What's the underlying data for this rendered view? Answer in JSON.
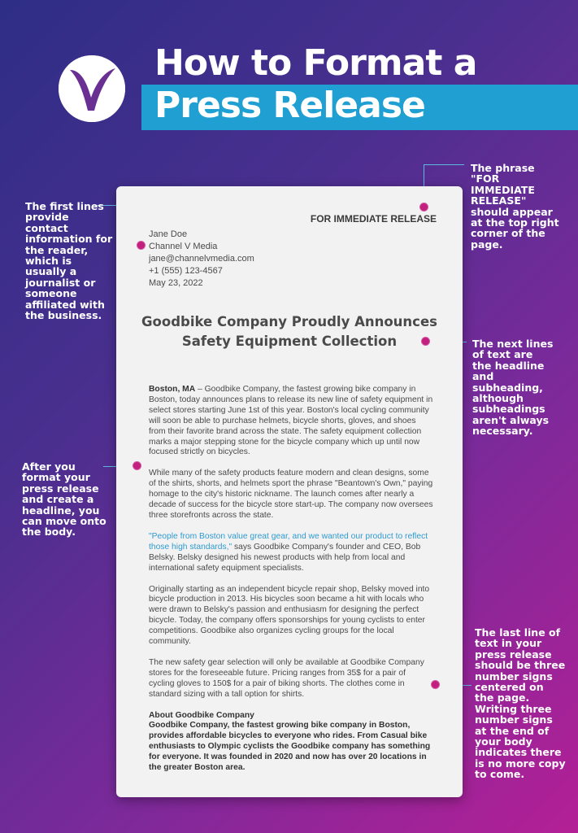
{
  "header": {
    "title_line1": "How to Format a",
    "title_line2": "Press Release",
    "brand_color": "#1f9fd2",
    "logo_icon": "channel-v-logo"
  },
  "document": {
    "for_immediate_release": "FOR IMMEDIATE RELEASE",
    "contact": {
      "name": "Jane Doe",
      "company": "Channel V Media",
      "email": "jane@channelvmedia.com",
      "phone": "+1 (555) 123-4567",
      "date": "May 23, 2022"
    },
    "headline_line1": "Goodbike Company Proudly Announces",
    "headline_line2": "Safety Equipment Collection",
    "p1_dateline": "Boston, MA",
    "p1_text": " – Goodbike Company, the fastest growing bike company in Boston, today announces plans to release its new line of safety equipment in select stores starting June 1st of this year. Boston's local cycling community will soon be able to purchase helmets, bicycle shorts, gloves, and shoes from their favorite brand across the state. The safety equipment collection marks a major stepping stone for the bicycle company which up until now focused strictly on bicycles.",
    "p2_text": "While many of the safety products feature modern and clean designs, some of the shirts, shorts, and helmets sport the phrase \"Beantown's Own,\" paying homage to the city's historic nickname. The launch comes after nearly a decade of success for the bicycle store start-up. The company now oversees three storefronts across the state.",
    "p3_quote": "\"People from Boston value great gear, and we wanted our product to reflect those high standards,\"",
    "p3_text": " says Goodbike Company's founder and CEO, Bob Belsky. Belsky designed his newest products with help from local and international safety equipment specialists.",
    "p4_text": "Originally starting as an independent bicycle repair shop, Belsky moved into bicycle production in 2013. His bicycles soon became a hit with locals who were drawn to Belsky's passion and enthusiasm for designing the perfect bicycle. Today, the company offers sponsorships for young cyclists to enter competitions. Goodbike also organizes cycling groups for the local community.",
    "p5_text": "The new safety gear selection will only be available at Goodbike Company stores for the foreseeable future. Pricing ranges from 35$ for a pair of cycling gloves to 150$ for a pair of biking shorts. The clothes come in standard sizing with a tall option for shirts.",
    "about_title": "About Goodbike Company",
    "about_text": "Goodbike Company, the fastest growing bike company in Boston, provides affordable bicycles to everyone who rides. From Casual bike enthusiasts to Olympic cyclists the Goodbike company has something for everyone. It was founded in 2020 and now has over 20 locations in the greater Boston area."
  },
  "annotations": {
    "contact_note": "The first lines provide contact information for the reader, which is usually a journalist or someone affiliated with the business.",
    "release_note": "The phrase \"FOR IMMEDIATE RELEASE\" should appear at the top right corner of the page.",
    "headline_note": "The next lines of text are the headline and subheading, although subheadings aren't always necessary.",
    "body_note": "After you format your press release and create a headline, you can move onto the body.",
    "end_note": "The last line of text in your press release should be three number signs centered on the page. Writing three number signs at the end of your body indicates there is no more copy to come.",
    "dot_color": "#c21f7f",
    "line_color": "#5fb8e0"
  }
}
